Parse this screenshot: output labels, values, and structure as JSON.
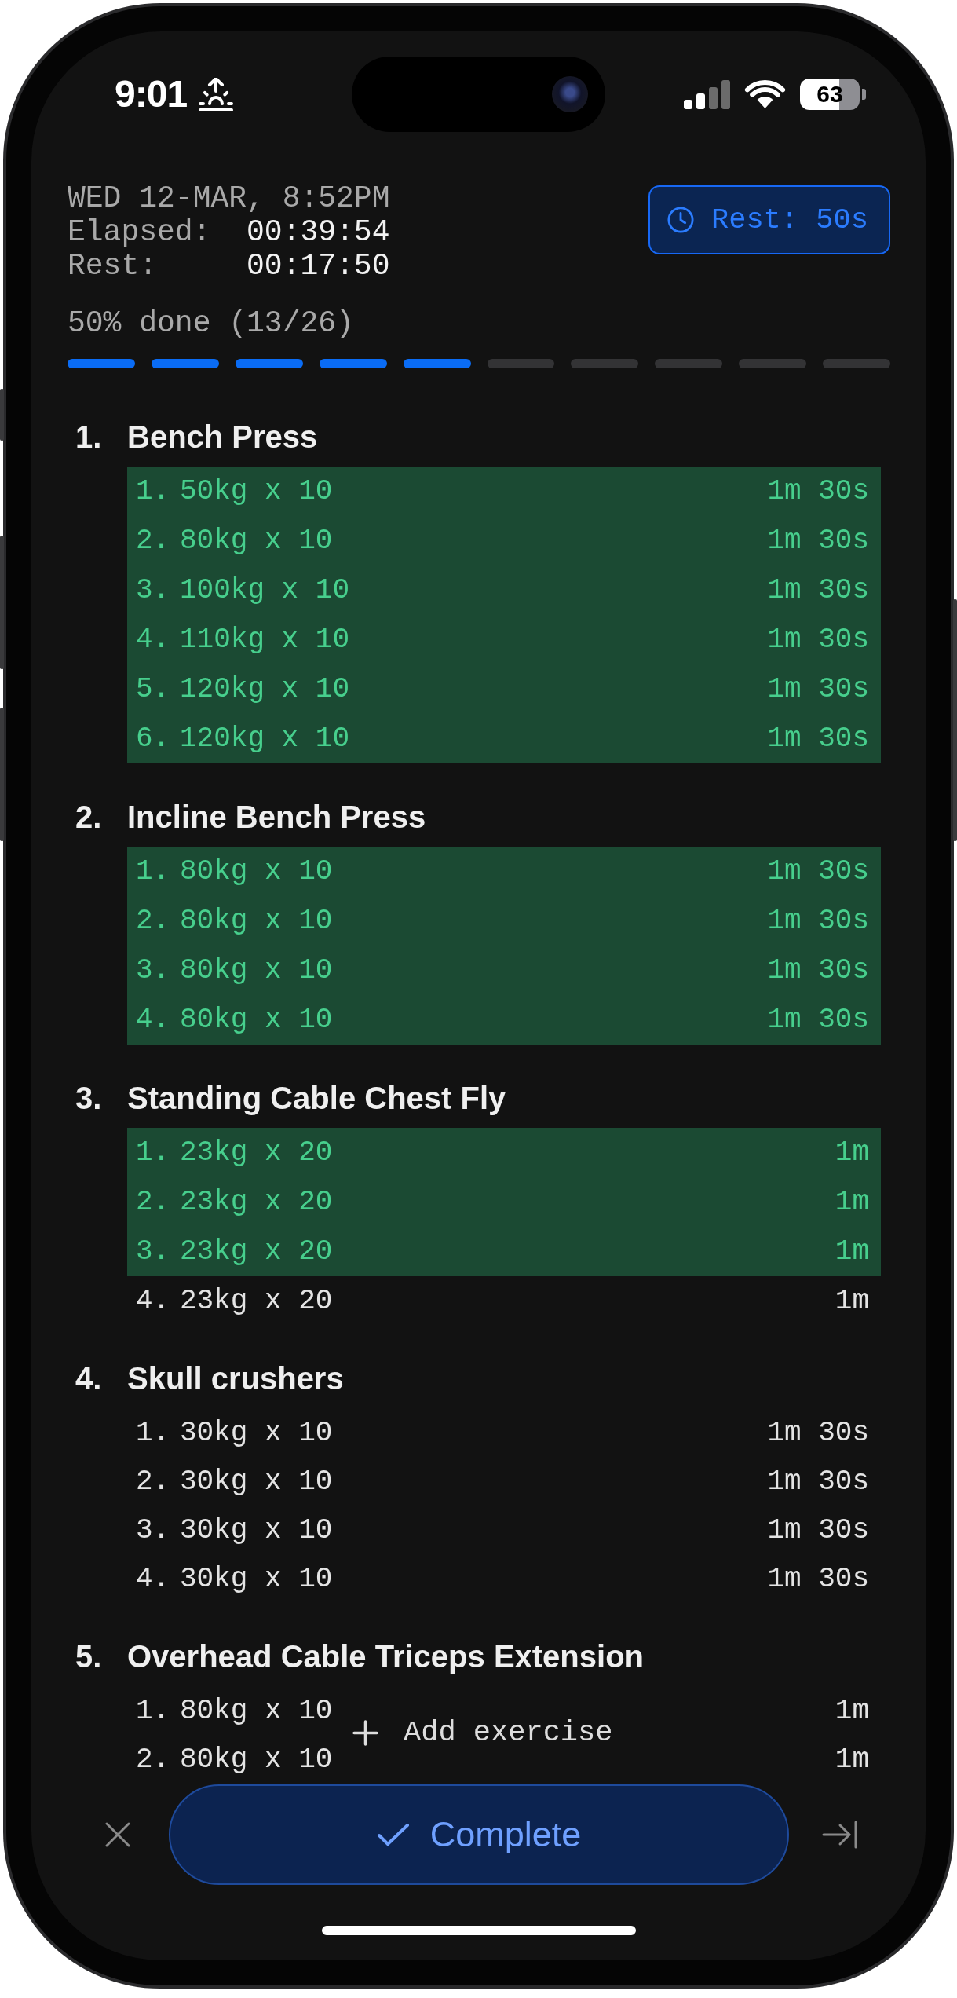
{
  "status_bar": {
    "time": "9:01",
    "battery": "63"
  },
  "header": {
    "date": "WED 12-MAR, 8:52PM",
    "timers": [
      {
        "label": "Elapsed:",
        "value": "00:39:54"
      },
      {
        "label": "Rest:",
        "value": "00:17:50"
      }
    ],
    "rest_button": {
      "label": "Rest: 50s"
    }
  },
  "progress": {
    "label": "50% done (13/26)",
    "segments": [
      {
        "filled": true
      },
      {
        "filled": true
      },
      {
        "filled": true
      },
      {
        "filled": true
      },
      {
        "filled": true
      },
      {
        "filled": false
      },
      {
        "filled": false
      },
      {
        "filled": false
      },
      {
        "filled": false
      },
      {
        "filled": false
      }
    ]
  },
  "exercises": [
    {
      "number": "1.",
      "name": "Bench Press",
      "sets": [
        {
          "number": "1.",
          "load": "50kg x 10",
          "rest": "1m 30s",
          "done": true
        },
        {
          "number": "2.",
          "load": "80kg x 10",
          "rest": "1m 30s",
          "done": true
        },
        {
          "number": "3.",
          "load": "100kg x 10",
          "rest": "1m 30s",
          "done": true
        },
        {
          "number": "4.",
          "load": "110kg x 10",
          "rest": "1m 30s",
          "done": true
        },
        {
          "number": "5.",
          "load": "120kg x 10",
          "rest": "1m 30s",
          "done": true
        },
        {
          "number": "6.",
          "load": "120kg x 10",
          "rest": "1m 30s",
          "done": true
        }
      ]
    },
    {
      "number": "2.",
      "name": "Incline Bench Press",
      "sets": [
        {
          "number": "1.",
          "load": "80kg x 10",
          "rest": "1m 30s",
          "done": true
        },
        {
          "number": "2.",
          "load": "80kg x 10",
          "rest": "1m 30s",
          "done": true
        },
        {
          "number": "3.",
          "load": "80kg x 10",
          "rest": "1m 30s",
          "done": true
        },
        {
          "number": "4.",
          "load": "80kg x 10",
          "rest": "1m 30s",
          "done": true
        }
      ]
    },
    {
      "number": "3.",
      "name": "Standing Cable Chest Fly",
      "sets": [
        {
          "number": "1.",
          "load": "23kg x 20",
          "rest": "1m",
          "done": true
        },
        {
          "number": "2.",
          "load": "23kg x 20",
          "rest": "1m",
          "done": true
        },
        {
          "number": "3.",
          "load": "23kg x 20",
          "rest": "1m",
          "done": true
        },
        {
          "number": "4.",
          "load": "23kg x 20",
          "rest": "1m",
          "done": false
        }
      ]
    },
    {
      "number": "4.",
      "name": "Skull crushers",
      "sets": [
        {
          "number": "1.",
          "load": "30kg x 10",
          "rest": "1m 30s",
          "done": false
        },
        {
          "number": "2.",
          "load": "30kg x 10",
          "rest": "1m 30s",
          "done": false
        },
        {
          "number": "3.",
          "load": "30kg x 10",
          "rest": "1m 30s",
          "done": false
        },
        {
          "number": "4.",
          "load": "30kg x 10",
          "rest": "1m 30s",
          "done": false
        }
      ]
    },
    {
      "number": "5.",
      "name": "Overhead Cable Triceps Extension",
      "sets": [
        {
          "number": "1.",
          "load": "80kg x 10",
          "rest": "1m",
          "done": false
        },
        {
          "number": "2.",
          "load": "80kg x 10",
          "rest": "1m",
          "done": false
        }
      ]
    }
  ],
  "add_exercise": {
    "label": "Add exercise"
  },
  "bottom_bar": {
    "complete_button": {
      "label": "Complete"
    }
  }
}
